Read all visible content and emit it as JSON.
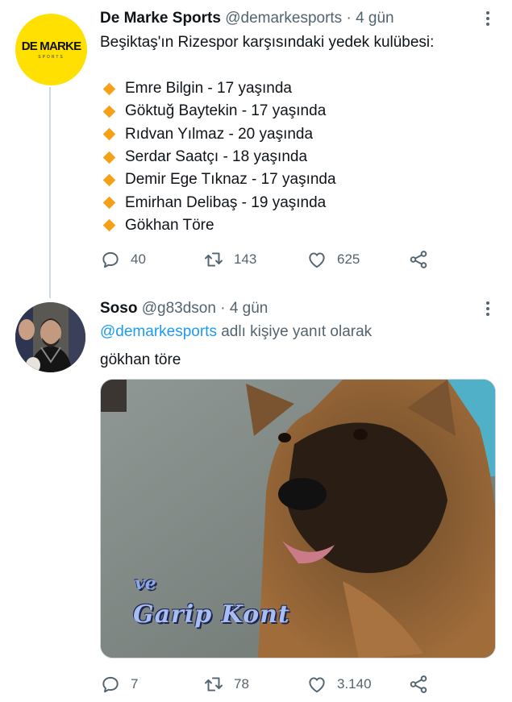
{
  "tweet": {
    "display_name": "De Marke Sports",
    "handle": "@demarkesports",
    "separator": "·",
    "time": "4 gün",
    "avatar_logo_main": "DE MARKE",
    "avatar_logo_sub": "SPORTS",
    "text": "Beşiktaş'ın Rizespor karşısındaki yedek kulübesi:",
    "list": [
      "Emre Bilgin - 17 yaşında",
      "Göktuğ Baytekin - 17 yaşında",
      "Rıdvan Yılmaz - 20 yaşında",
      "Serdar Saatçı - 18 yaşında",
      "Demir Ege Tıknaz - 17 yaşında",
      "Emirhan Delibaş - 19 yaşında",
      "Gökhan Töre"
    ],
    "replies": "40",
    "retweets": "143",
    "likes": "625",
    "bullet_color": "#f4a118"
  },
  "reply": {
    "display_name": "Soso",
    "handle": "@g83dson",
    "separator": "·",
    "time": "4 gün",
    "replying_to_mention": "@demarkesports",
    "replying_to_suffix": "adlı kişiye yanıt olarak",
    "text": "gökhan töre",
    "media_caption_1": "ve",
    "media_caption_2": "Garip Kont",
    "replies": "7",
    "retweets": "78",
    "likes": "3.140"
  },
  "colors": {
    "text_primary": "#0f1419",
    "text_secondary": "#536471",
    "link": "#1d9bf0",
    "thread_line": "#cfd9de"
  },
  "icons": [
    "reply-icon",
    "retweet-icon",
    "like-icon",
    "share-icon",
    "more-icon"
  ]
}
